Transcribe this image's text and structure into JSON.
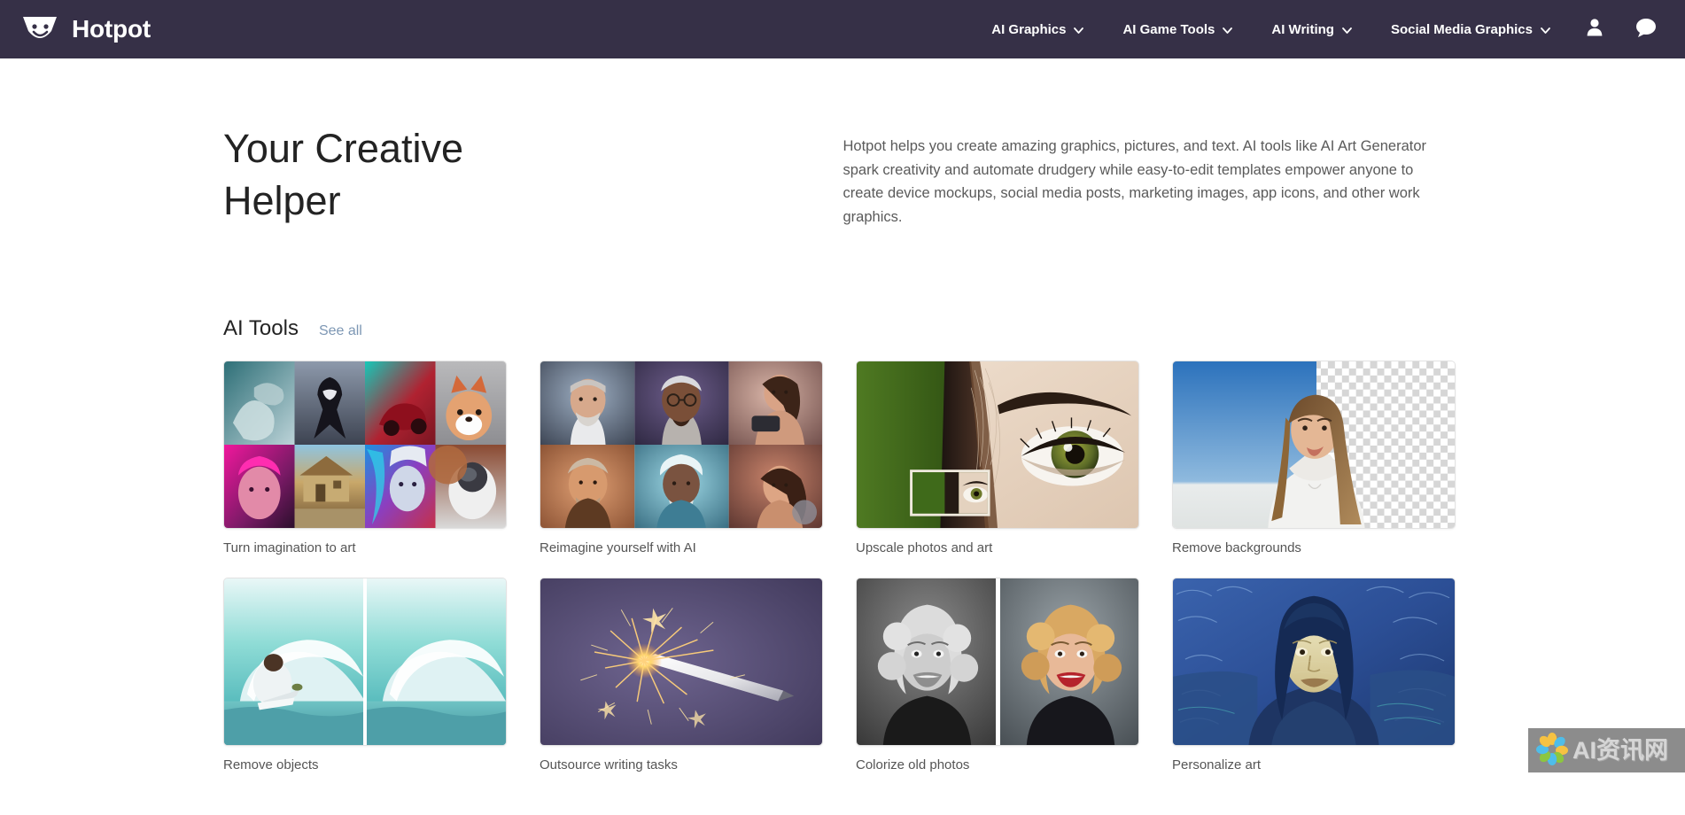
{
  "navbar": {
    "brand": {
      "name": "Hotpot",
      "logo_icon": "hotpot-smiley-logo"
    },
    "menu": [
      {
        "label": "AI Graphics",
        "icon": "chevron-down-icon"
      },
      {
        "label": "AI Game Tools",
        "icon": "chevron-down-icon"
      },
      {
        "label": "AI Writing",
        "icon": "chevron-down-icon"
      },
      {
        "label": "Social Media Graphics",
        "icon": "chevron-down-icon"
      }
    ],
    "account_icon": "user-account-icon",
    "chat_icon": "chat-bubble-icon",
    "background_color": "#363047"
  },
  "hero": {
    "title": "Your Creative Helper",
    "paragraph": "Hotpot helps you create amazing graphics, pictures, and text. AI tools like AI Art Generator spark creativity and automate drudgery while easy-to-edit templates empower anyone to create device mockups, social media posts, marketing images, app icons, and other work graphics."
  },
  "tools_section": {
    "title": "AI Tools",
    "see_all_label": "See all",
    "see_all_color": "#7d97b4",
    "cards": [
      {
        "label": "Turn imagination to art",
        "thumb": "ai-art-grid-collage"
      },
      {
        "label": "Reimagine yourself with AI",
        "thumb": "ai-portrait-grid-collage"
      },
      {
        "label": "Upscale photos and art",
        "thumb": "eye-closeup-upscale-compare"
      },
      {
        "label": "Remove backgrounds",
        "thumb": "portrait-transparent-background"
      },
      {
        "label": "Remove objects",
        "thumb": "surfer-wave-object-removal"
      },
      {
        "label": "Outsource writing tasks",
        "thumb": "sparking-pen-on-purple"
      },
      {
        "label": "Colorize old photos",
        "thumb": "bw-to-color-portrait"
      },
      {
        "label": "Personalize art",
        "thumb": "mona-lisa-van-gogh-style"
      }
    ]
  },
  "watermark": {
    "text": "AI资讯网",
    "logo_icon": "pinwheel-flower-logo"
  }
}
